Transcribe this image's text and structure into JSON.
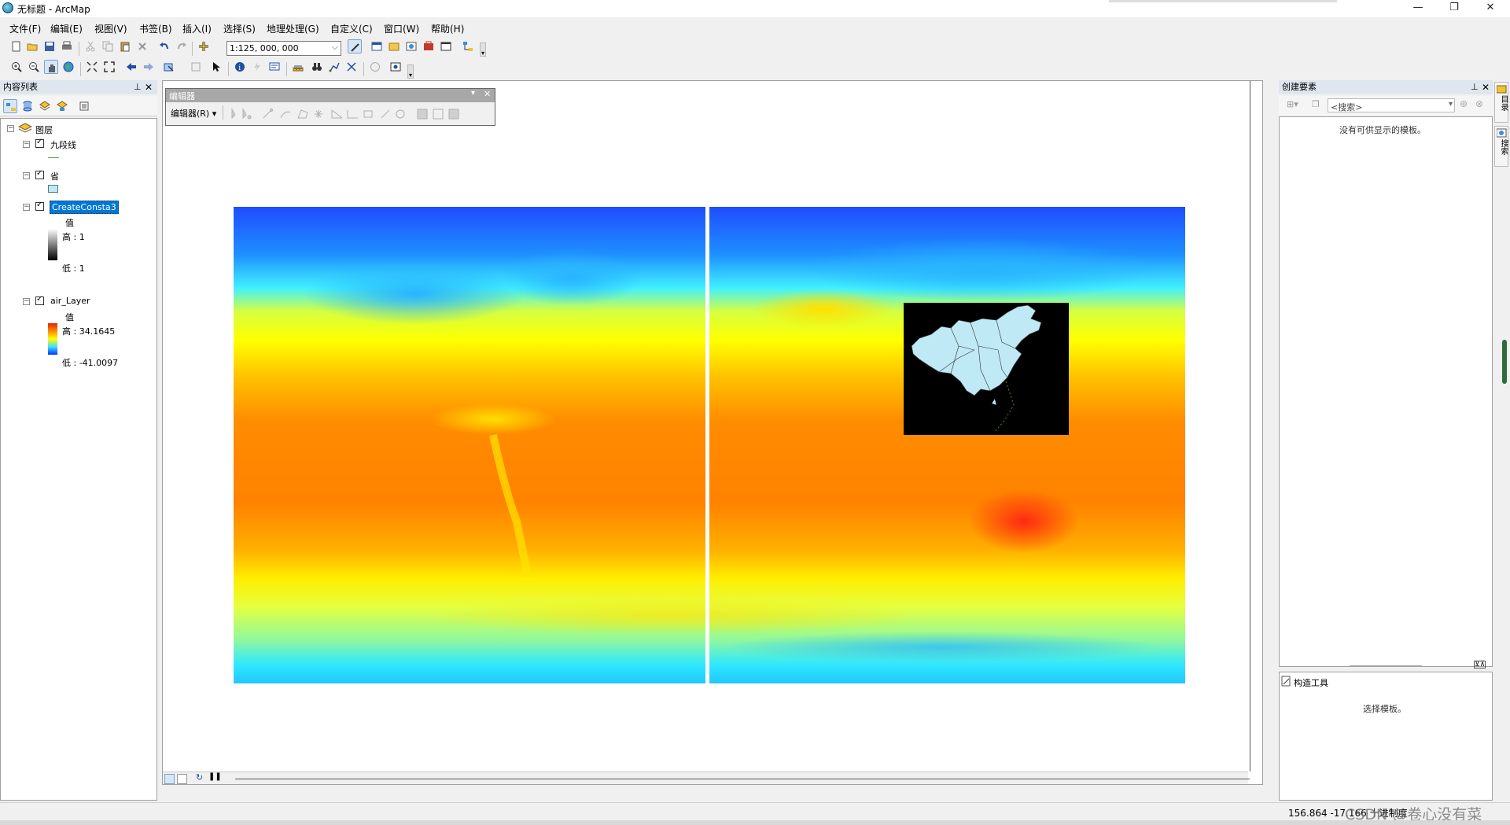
{
  "window": {
    "title": "无标题 - ArcMap",
    "controls": [
      "—",
      "❐",
      "✕"
    ]
  },
  "menu": [
    "文件(F)",
    "编辑(E)",
    "视图(V)",
    "书签(B)",
    "插入(I)",
    "选择(S)",
    "地理处理(G)",
    "自定义(C)",
    "窗口(W)",
    "帮助(H)"
  ],
  "toolbar": {
    "scale_value": "1:125, 000, 000"
  },
  "toc": {
    "title": "内容列表",
    "root_label": "图层",
    "layers": [
      {
        "name": "九段线",
        "checked": true
      },
      {
        "name": "省",
        "checked": true
      },
      {
        "name": "CreateConsta3",
        "checked": true,
        "selected": true,
        "legend_title": "值",
        "high": "高 : 1",
        "low": "低 : 1"
      },
      {
        "name": "air_Layer",
        "checked": true,
        "legend_title": "值",
        "high": "高 : 34.1645",
        "low": "低 : -41.0097"
      }
    ]
  },
  "editor": {
    "title": "编辑器",
    "menu_label": "编辑器(R) ▾"
  },
  "create_features": {
    "title": "创建要素",
    "search_placeholder": "<搜索>",
    "empty_msg": "没有可供显示的模板。",
    "construct_title": "构造工具",
    "construct_msg": "选择模板。"
  },
  "side_tabs": [
    "目录",
    "搜索"
  ],
  "status": {
    "coords": "156.864 -17.166 十进制度",
    "watermark": "CSDN @卷心没有菜"
  },
  "colors": {
    "selection": "#0078d7",
    "map_bg": "#ffffff",
    "inset_bg": "#000000",
    "china_fill": "#bfe9f5"
  }
}
